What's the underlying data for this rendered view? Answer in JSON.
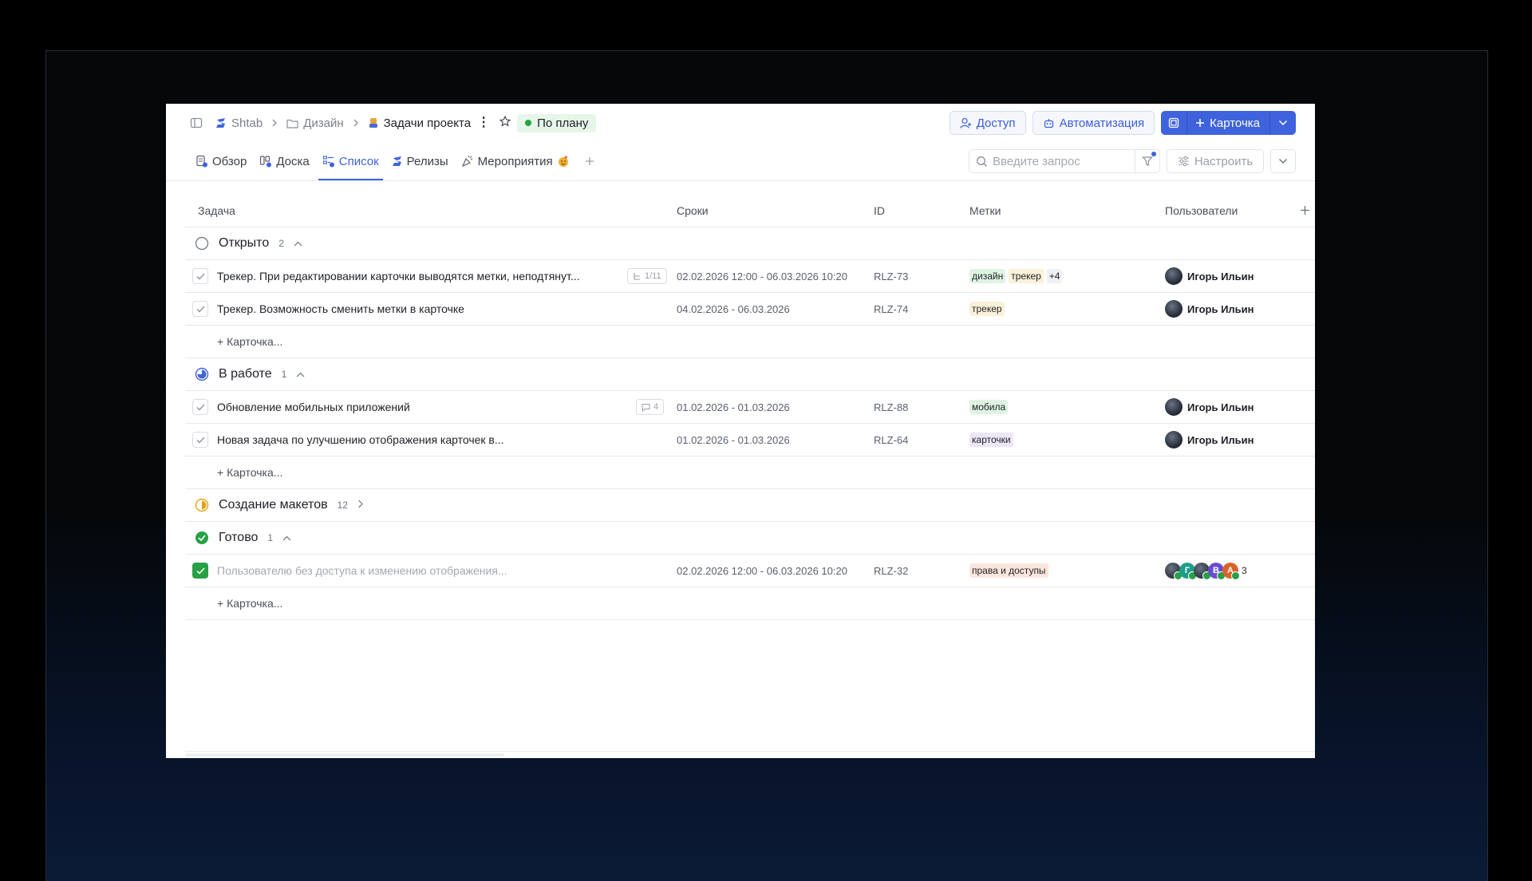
{
  "breadcrumb": {
    "workspace": "Shtab",
    "folder": "Дизайн",
    "project": "Задачи проекта",
    "status": "По плану"
  },
  "actions": {
    "access": "Доступ",
    "automation": "Автоматизация",
    "card": "Карточка"
  },
  "tabs": [
    {
      "label": "Обзор"
    },
    {
      "label": "Доска"
    },
    {
      "label": "Список",
      "active": true
    },
    {
      "label": "Релизы"
    },
    {
      "label": "Мероприятия"
    }
  ],
  "search": {
    "placeholder": "Введите запрос",
    "value": ""
  },
  "configure": "Настроить",
  "columns": {
    "task": "Задача",
    "dates": "Сроки",
    "id": "ID",
    "tags": "Метки",
    "users": "Пользователи"
  },
  "add_card_label": "+ Карточка...",
  "groups": {
    "open": {
      "name": "Открыто",
      "count": "2",
      "rows": [
        {
          "title": "Трекер. При редактировании карточки выводятся метки, неподтянут...",
          "subtasks": "1/11",
          "dates": "02.02.2026 12:00 - 06.03.2026 10:20",
          "id": "RLZ-73",
          "tags": [
            "дизайн",
            "трекер"
          ],
          "tags_more": "+4",
          "user": "Игорь Ильин"
        },
        {
          "title": "Трекер. Возможность сменить метки в карточке",
          "dates": "04.02.2026 - 06.03.2026",
          "id": "RLZ-74",
          "tags": [
            "трекер"
          ],
          "user": "Игорь Ильин"
        }
      ]
    },
    "inwork": {
      "name": "В работе",
      "count": "1",
      "rows": [
        {
          "title": "Обновление мобильных приложений",
          "comments": "4",
          "dates": "01.02.2026 - 01.03.2026",
          "id": "RLZ-88",
          "tags": [
            "мобила"
          ],
          "user": "Игорь Ильин"
        },
        {
          "title": "Новая задача по улучшению отображения карточек в...",
          "dates": "01.02.2026 - 01.03.2026",
          "id": "RLZ-64",
          "tags": [
            "карточки"
          ],
          "user": "Игорь Ильин"
        }
      ]
    },
    "mockups": {
      "name": "Создание макетов",
      "count": "12"
    },
    "done": {
      "name": "Готово",
      "count": "1",
      "rows": [
        {
          "title": "Пользователю без доступа к изменению отображения...",
          "dates": "02.02.2026 12:00 - 06.03.2026 10:20",
          "id": "RLZ-32",
          "tags": [
            "права и доступы"
          ],
          "avatar_letters": [
            "Г",
            "В",
            "А"
          ],
          "users_more": "3"
        }
      ]
    }
  },
  "colors": {
    "accent": "#3e63dd",
    "done": "#27a046",
    "tag_design": "#dff3e3",
    "tag_tracker": "#fbf1d9",
    "tag_mobile": "#dff3e3",
    "tag_cards": "#ece6f7",
    "tag_rights": "#fbe6dd"
  }
}
